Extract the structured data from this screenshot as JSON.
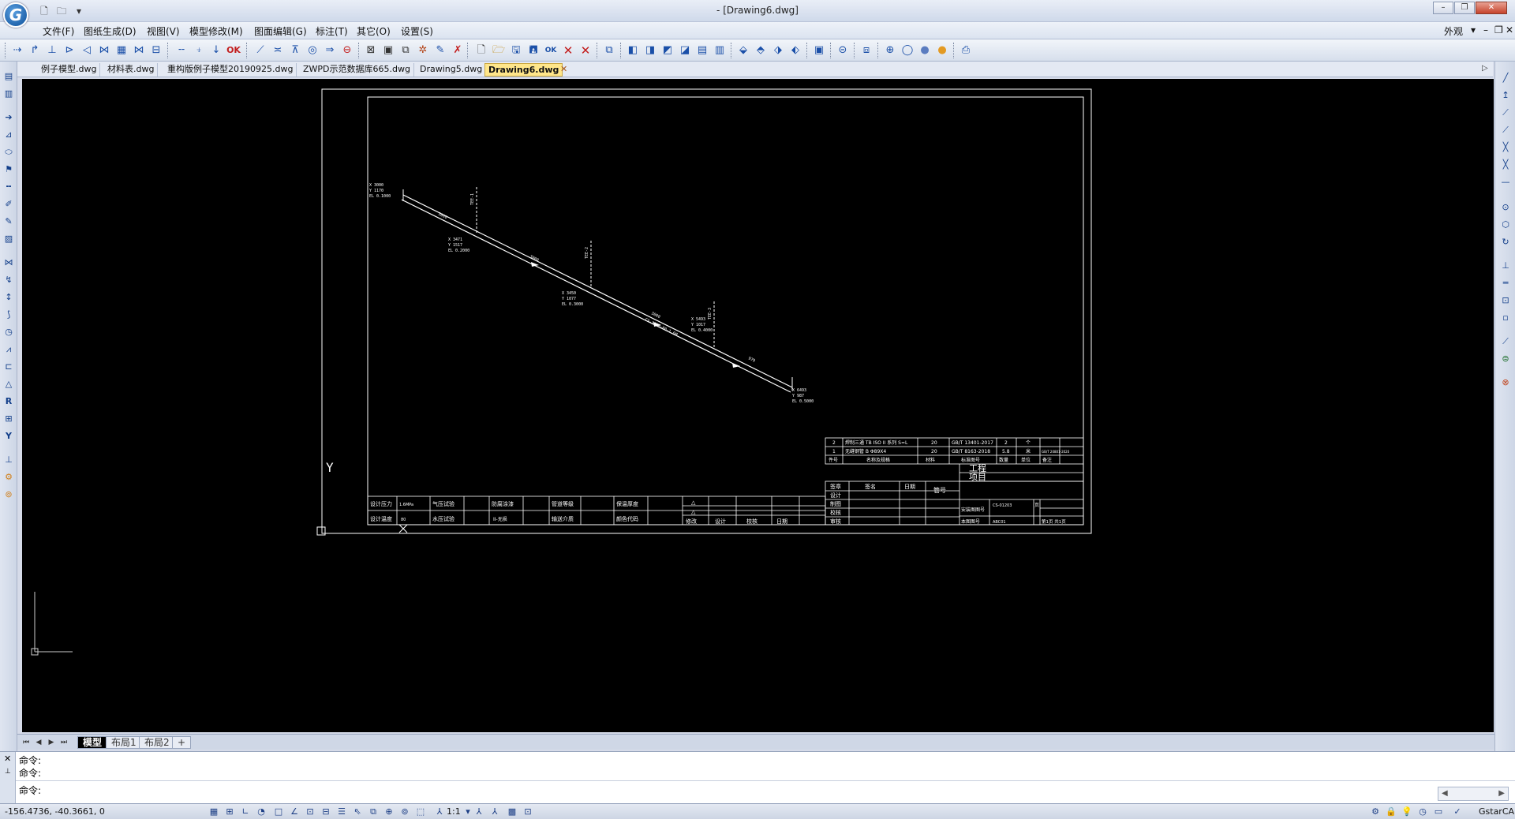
{
  "window": {
    "title": "- [Drawing6.dwg]",
    "logo_letter": "G"
  },
  "titlebar": {
    "minimize": "–",
    "restore": "❐",
    "close": "✕"
  },
  "menu": {
    "items": [
      "文件(F)",
      "图纸生成(D)",
      "视图(V)",
      "模型修改(M)",
      "图面编辑(G)",
      "标注(T)",
      "其它(O)",
      "设置(S)"
    ],
    "appearance": "外观",
    "doc_close": "✕"
  },
  "file_tabs": [
    "例子模型.dwg",
    "材料表.dwg",
    "重构版例子模型20190925.dwg",
    "ZWPD示范数据库665.dwg",
    "Drawing5.dwg",
    "Drawing6.dwg"
  ],
  "active_file_tab": "Drawing6.dwg",
  "tab_close": "✕",
  "layout_tabs": [
    "模型",
    "布局1",
    "布局2"
  ],
  "layout_add": "+",
  "command": {
    "lines": [
      "命令:",
      "命令:"
    ],
    "prompt": "命令:"
  },
  "status": {
    "coords": "-156.4736, -40.3661, 0",
    "scale": "1:1",
    "brand": "GstarCAD"
  },
  "drawing": {
    "table_top": {
      "rows": [
        [
          "2",
          "焊制三通 TB ISO II 系列 S=L",
          "20",
          "GB/T 13401-2017",
          "2",
          "个",
          ""
        ],
        [
          "1",
          "无缝钢管 B Φ89X4",
          "20",
          "GB/T 8163-2018",
          "5.8",
          "米",
          "GB/T 20801-2020"
        ]
      ],
      "header": [
        "件号",
        "名称及规格",
        "材料",
        "标准图号",
        "数量",
        "单位",
        "备注"
      ]
    },
    "table_left": {
      "row1": [
        "设计压力",
        "1.6MPa",
        "气压试验",
        "",
        "防腐涂漆",
        "",
        "管道等级",
        "",
        "保温厚度",
        ""
      ],
      "row2": [
        "设计温度",
        "80",
        "水压试验",
        "",
        "II-无损",
        "",
        "输送介质",
        "",
        "颜色代码",
        ""
      ]
    },
    "revision": {
      "mark": "△",
      "cols": [
        "修改",
        "设计",
        "校核",
        "日期"
      ]
    },
    "signatures": {
      "head": [
        "签章",
        "签名",
        "日期"
      ],
      "roles": [
        "设计",
        "制图",
        "校核",
        "审核"
      ]
    },
    "title_block": {
      "project": "工程",
      "item": "项目",
      "pipe_no_label": "管号",
      "diagram_no_label": "安装图图号",
      "diagram_no": "CS-01203",
      "this_no_label": "本图图号",
      "this_no": "ABC01",
      "page_label": "页",
      "sheet": "第1页 共1页"
    },
    "axis_label": "Y",
    "pipe_labels": {
      "start": [
        "X 3000",
        "Y 1170",
        "EL 0.1000"
      ],
      "seg1": "3000",
      "node1": [
        "X 3471",
        "Y 1517",
        "EL 0.2000"
      ],
      "seg2": "3000",
      "node2": [
        "X 3450",
        "Y 1077",
        "EL 0.3000"
      ],
      "seg3": "3000",
      "node3": [
        "X 5493",
        "Y 1017",
        "EL 0.4000"
      ],
      "seg4": "979",
      "end": [
        "X 6493",
        "Y 987",
        "EL 0.5000"
      ],
      "branch1": "TEE-1",
      "branch2": "TEE-2",
      "branch3": "TEE-3",
      "line_spec": "CS-3000-80-1.6M"
    }
  }
}
